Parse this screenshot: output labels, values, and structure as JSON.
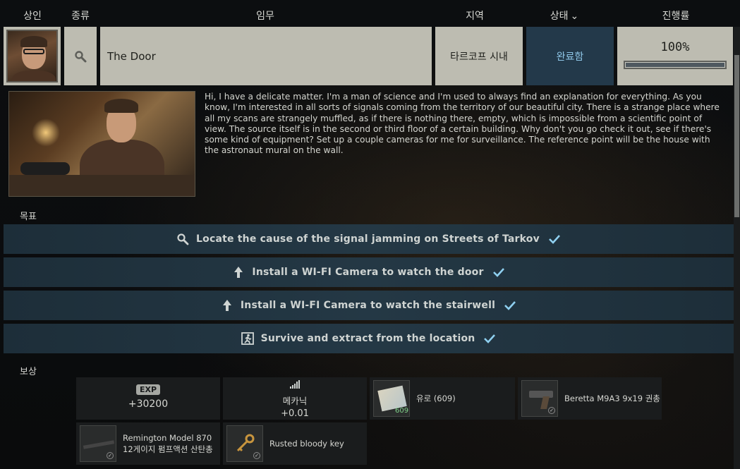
{
  "header": {
    "trader": "상인",
    "type": "종류",
    "task": "임무",
    "location": "지역",
    "status": "상태",
    "progress": "진행률"
  },
  "quest": {
    "type_icon": "search-icon",
    "name": "The Door",
    "location": "타르코프 시내",
    "status": "완료함",
    "progress_text": "100%",
    "progress_fraction": 1.0
  },
  "description": "Hi, I have a delicate matter. I'm a man of science and I'm used to always find an explanation for everything. As you know, I'm interested in all sorts of signals coming from the territory of our beautiful city. There is a strange place where all my scans are strangely muffled, as if there is nothing there, empty, which is impossible from a scientific point of view. The source itself is in the second or third floor of a certain building. Why don't you go check it out, see if there's some kind of equipment? Set up a couple cameras for me for surveillance. The reference point will be the house with the astronaut mural on the wall.",
  "goals_label": "목표",
  "goals": [
    {
      "icon": "search-icon",
      "text": "Locate the cause of the signal jamming on Streets of Tarkov"
    },
    {
      "icon": "arrow-up-icon",
      "text": "Install a WI-FI Camera to watch the door"
    },
    {
      "icon": "arrow-up-icon",
      "text": "Install a WI-FI Camera to watch the stairwell"
    },
    {
      "icon": "exit-icon",
      "text": "Survive and extract from the location"
    }
  ],
  "rewards_label": "보상",
  "rewards": {
    "exp_badge": "EXP",
    "exp_value": "+30200",
    "mechanic_name": "메카닉",
    "mechanic_value": "+0.01",
    "euro_name": "유로  (609)",
    "euro_count": "609",
    "beretta": "Beretta M9A3 9x19 권총",
    "remington_line1": "Remington Model 870",
    "remington_line2": "12게이지 펌프액션 산탄총",
    "key": "Rusted bloody key"
  },
  "colors": {
    "status_bg": "#23394a",
    "status_text": "#8fc7e8",
    "check": "#8fd0f0"
  }
}
